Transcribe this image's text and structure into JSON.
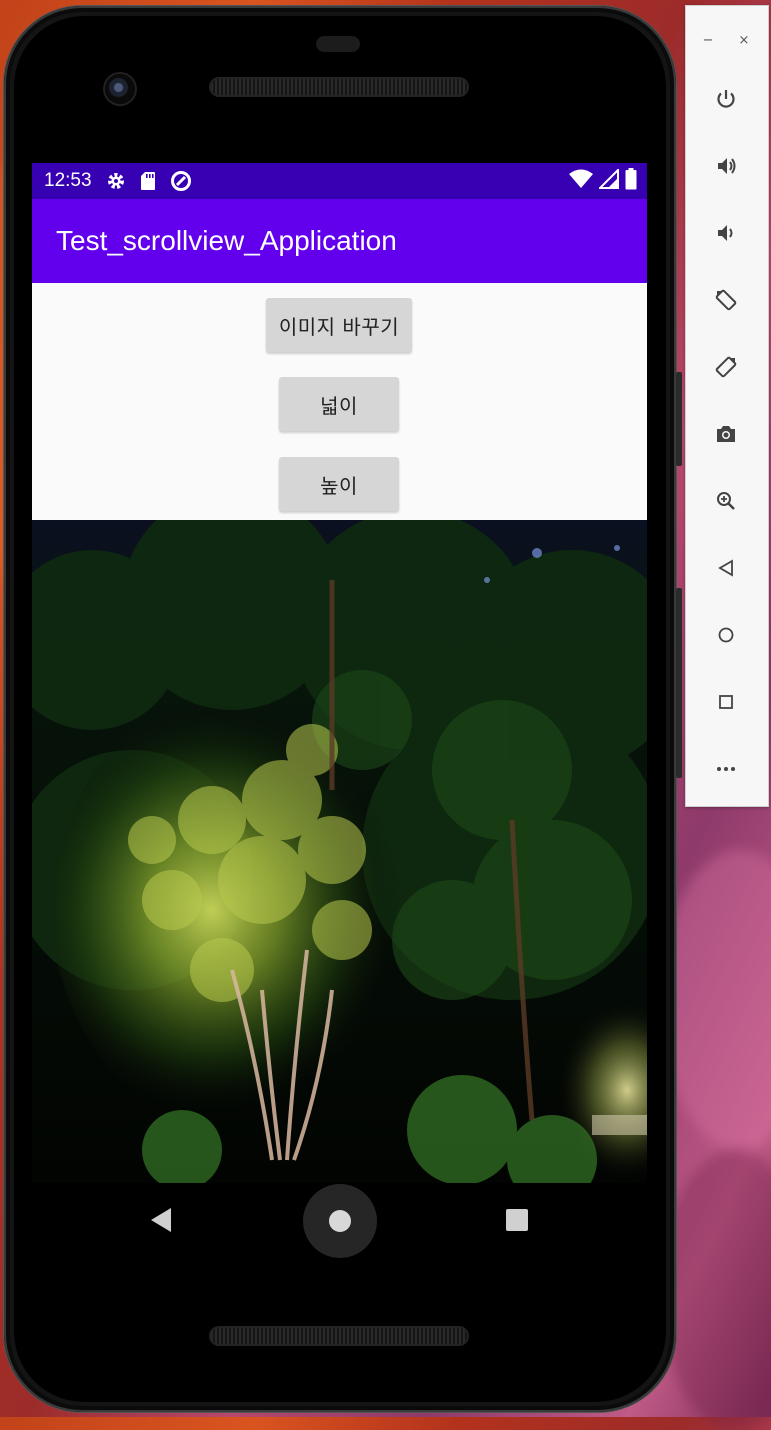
{
  "status_bar": {
    "time": "12:53",
    "icons": [
      "settings-icon",
      "sd-card-icon",
      "data-saver-icon",
      "wifi-icon",
      "signal-icon",
      "battery-icon"
    ]
  },
  "app_bar": {
    "title": "Test_scrollview_Application",
    "color": "#6200ee",
    "status_color": "#3700b3"
  },
  "buttons": {
    "change_image": "이미지 바꾸기",
    "width": "넓이",
    "height": "높이"
  },
  "image": {
    "subject": "night-forest-photo"
  },
  "nav_bar": {
    "items": [
      "back-icon",
      "home-icon",
      "recents-icon"
    ]
  },
  "emulator_panel": {
    "window_minimize": "−",
    "window_close": "×",
    "controls": [
      "power-icon",
      "volume-up-icon",
      "volume-down-icon",
      "rotate-left-icon",
      "rotate-right-icon",
      "screenshot-icon",
      "zoom-icon",
      "back-icon",
      "home-icon",
      "overview-icon",
      "more-icon"
    ]
  }
}
